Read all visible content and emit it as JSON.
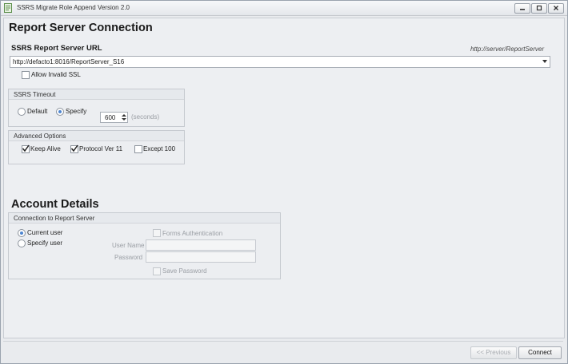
{
  "window": {
    "title": "SSRS Migrate Role Append Version 2.0"
  },
  "server": {
    "heading": "Report Server Connection",
    "url_label": "SSRS Report Server URL",
    "url_hint": "http://server/ReportServer",
    "url_value": "http://defacto1:8016/ReportServer_S16",
    "allow_invalid_ssl": {
      "label": "Allow Invalid SSL",
      "checked": false
    }
  },
  "timeout": {
    "title": "SSRS Timeout",
    "default_label": "Default",
    "specify_label": "Specify",
    "selected": "Specify",
    "value": "600",
    "unit": "(seconds)"
  },
  "advanced": {
    "title": "Advanced Options",
    "keep_alive": {
      "label": "Keep Alive",
      "checked": true
    },
    "protocol_ver": {
      "label": "Protocol Ver 11",
      "checked": true
    },
    "except_100": {
      "label": "Except 100",
      "checked": false
    }
  },
  "account": {
    "heading": "Account Details",
    "group_title": "Connection to Report Server",
    "current_user": "Current user",
    "specify_user": "Specify user",
    "selected": "Current user",
    "forms_auth": "Forms Authentication",
    "user_name_label": "User Name",
    "password_label": "Password",
    "save_password": "Save Password"
  },
  "footer": {
    "previous_label": "<< Previous",
    "connect_label": "Connect"
  }
}
